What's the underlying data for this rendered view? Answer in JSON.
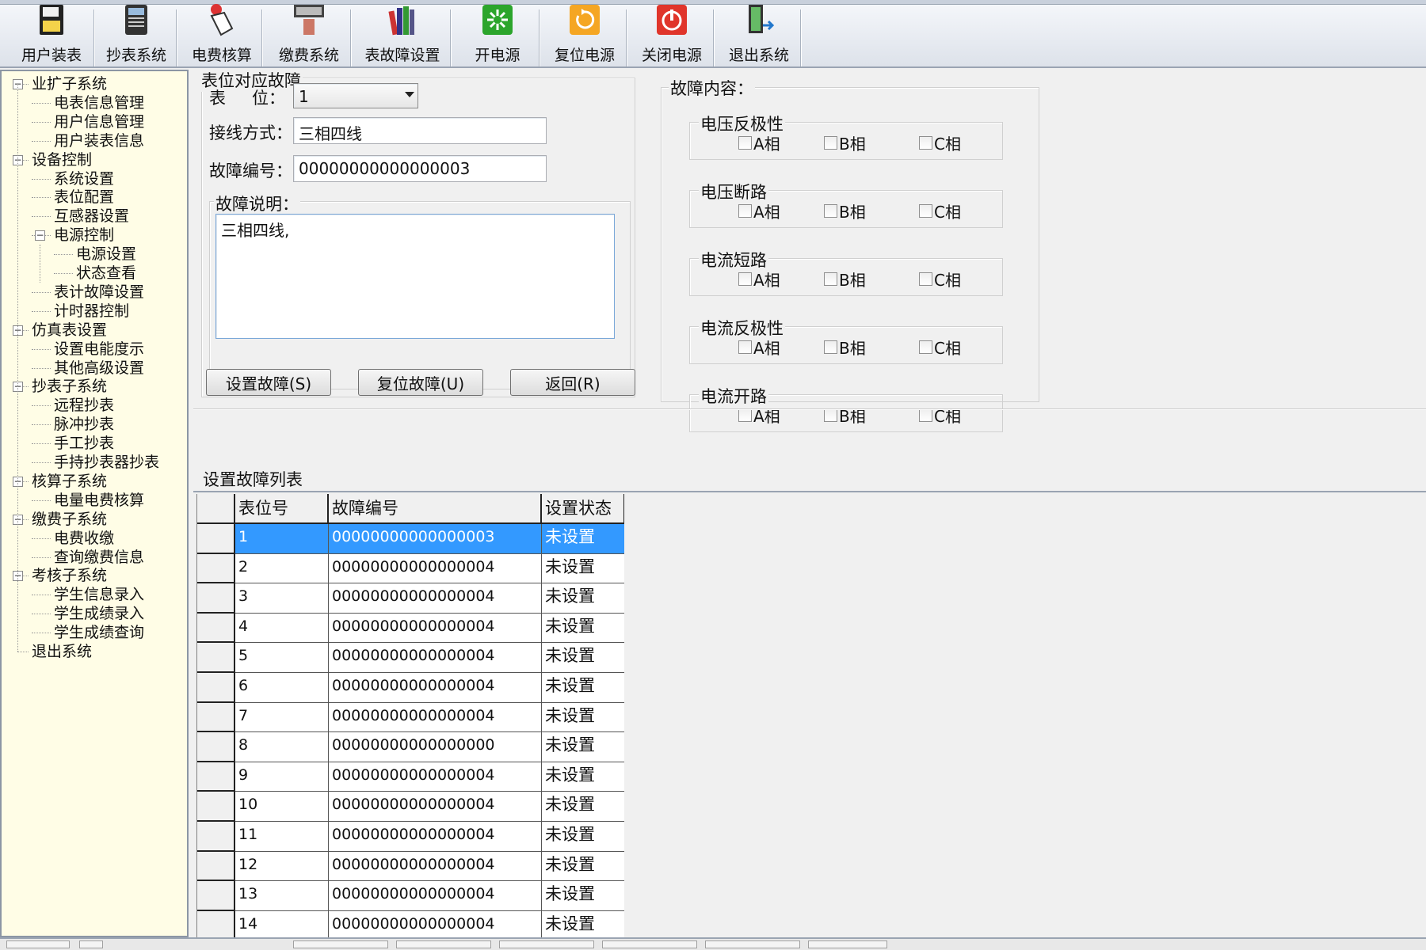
{
  "toolbar": {
    "items": [
      {
        "label": "用户装表",
        "icon": "meter-install-icon"
      },
      {
        "label": "抄表系统",
        "icon": "meter-reading-icon"
      },
      {
        "label": "电费核算",
        "icon": "calculator-hand-icon"
      },
      {
        "label": "缴费系统",
        "icon": "payment-terminal-icon"
      },
      {
        "label": "表故障设置",
        "icon": "books-icon"
      },
      {
        "label": "开电源",
        "icon": "power-on-icon"
      },
      {
        "label": "复位电源",
        "icon": "reset-power-icon"
      },
      {
        "label": "关闭电源",
        "icon": "power-off-icon"
      },
      {
        "label": "退出系统",
        "icon": "exit-door-icon"
      }
    ]
  },
  "sidebar": {
    "items": [
      {
        "label": "业扩子系统",
        "level": 0,
        "expander": "⊟"
      },
      {
        "label": "电表信息管理",
        "level": 1
      },
      {
        "label": "用户信息管理",
        "level": 1
      },
      {
        "label": "用户装表信息",
        "level": 1
      },
      {
        "label": "设备控制",
        "level": 0,
        "expander": "⊟"
      },
      {
        "label": "系统设置",
        "level": 1
      },
      {
        "label": "表位配置",
        "level": 1
      },
      {
        "label": "互感器设置",
        "level": 1
      },
      {
        "label": "电源控制",
        "level": 1,
        "expander": "⊟"
      },
      {
        "label": "电源设置",
        "level": 2
      },
      {
        "label": "状态查看",
        "level": 2
      },
      {
        "label": "表计故障设置",
        "level": 1
      },
      {
        "label": "计时器控制",
        "level": 1
      },
      {
        "label": "仿真表设置",
        "level": 0,
        "expander": "⊟"
      },
      {
        "label": "设置电能度示",
        "level": 1
      },
      {
        "label": "其他高级设置",
        "level": 1
      },
      {
        "label": "抄表子系统",
        "level": 0,
        "expander": "⊟"
      },
      {
        "label": "远程抄表",
        "level": 1
      },
      {
        "label": "脉冲抄表",
        "level": 1
      },
      {
        "label": "手工抄表",
        "level": 1
      },
      {
        "label": "手持抄表器抄表",
        "level": 1
      },
      {
        "label": "核算子系统",
        "level": 0,
        "expander": "⊟"
      },
      {
        "label": "电量电费核算",
        "level": 1
      },
      {
        "label": "缴费子系统",
        "level": 0,
        "expander": "⊟"
      },
      {
        "label": "电费收缴",
        "level": 1
      },
      {
        "label": "查询缴费信息",
        "level": 1
      },
      {
        "label": "考核子系统",
        "level": 0,
        "expander": "⊟"
      },
      {
        "label": "学生信息录入",
        "level": 1
      },
      {
        "label": "学生成绩录入",
        "level": 1
      },
      {
        "label": "学生成绩查询",
        "level": 1
      },
      {
        "label": "退出系统",
        "level": 0
      }
    ]
  },
  "form": {
    "group_title": "表位对应故障",
    "position_label_1": "表",
    "position_label_2": "位：",
    "position_value": "1",
    "wiring_label": "接线方式：",
    "wiring_value": "三相四线",
    "fault_code_label": "故障编号：",
    "fault_code_value": "00000000000000003",
    "desc_label": "故障说明：",
    "desc_value": "三相四线,",
    "buttons": {
      "set": "设置故障(S)",
      "reset": "复位故障(U)",
      "back": "返回(R)"
    }
  },
  "fault_content": {
    "title": "故障内容：",
    "groups": [
      {
        "title": "电压反极性",
        "options": [
          "A相",
          "B相",
          "C相"
        ]
      },
      {
        "title": "电压断路",
        "options": [
          "A相",
          "B相",
          "C相"
        ]
      },
      {
        "title": "电流短路",
        "options": [
          "A相",
          "B相",
          "C相"
        ]
      },
      {
        "title": "电流反极性",
        "options": [
          "A相",
          "B相",
          "C相"
        ]
      },
      {
        "title": "电流开路",
        "options": [
          "A相",
          "B相",
          "C相"
        ]
      }
    ]
  },
  "fault_list": {
    "title": "设置故障列表",
    "columns": [
      "表位号",
      "故障编号",
      "设置状态"
    ],
    "rows": [
      {
        "pos": "1",
        "code": "00000000000000003",
        "status": "未设置",
        "selected": true
      },
      {
        "pos": "2",
        "code": "00000000000000004",
        "status": "未设置"
      },
      {
        "pos": "3",
        "code": "00000000000000004",
        "status": "未设置"
      },
      {
        "pos": "4",
        "code": "00000000000000004",
        "status": "未设置"
      },
      {
        "pos": "5",
        "code": "00000000000000004",
        "status": "未设置"
      },
      {
        "pos": "6",
        "code": "00000000000000004",
        "status": "未设置"
      },
      {
        "pos": "7",
        "code": "00000000000000004",
        "status": "未设置"
      },
      {
        "pos": "8",
        "code": "00000000000000000",
        "status": "未设置"
      },
      {
        "pos": "9",
        "code": "00000000000000004",
        "status": "未设置"
      },
      {
        "pos": "10",
        "code": "00000000000000004",
        "status": "未设置"
      },
      {
        "pos": "11",
        "code": "00000000000000004",
        "status": "未设置"
      },
      {
        "pos": "12",
        "code": "00000000000000004",
        "status": "未设置"
      },
      {
        "pos": "13",
        "code": "00000000000000004",
        "status": "未设置"
      },
      {
        "pos": "14",
        "code": "00000000000000004",
        "status": "未设置"
      }
    ]
  },
  "colors": {
    "selection": "#3399ff",
    "sidebar_bg": "#fffde6"
  }
}
